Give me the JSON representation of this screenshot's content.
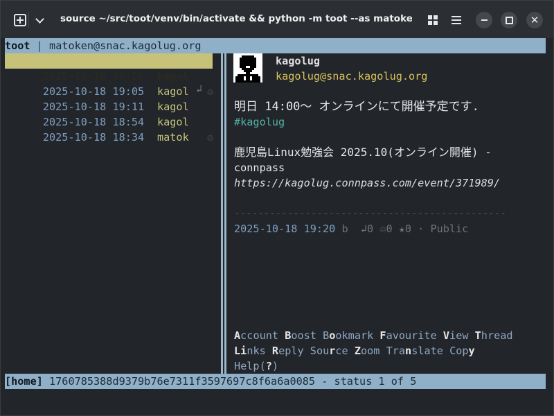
{
  "window": {
    "title": "source ~/src/toot/venv/bin/activate && python -m toot --as matoken@sna…"
  },
  "header": {
    "app": "toot",
    "separator": "|",
    "user": "matoken@snac.kagolug.org"
  },
  "timeline": [
    {
      "time": "2025-10-18 19:20",
      "account": "kagol",
      "icon": "",
      "selected": true
    },
    {
      "time": "2025-10-18 19:05",
      "account": "kagol",
      "icon": "♲",
      "icon_name": "boost-icon"
    },
    {
      "time": "2025-10-18 19:11",
      "account": "kagol",
      "icon": "↲",
      "icon_name": "reply-icon"
    },
    {
      "time": "2025-10-18 18:54",
      "account": "kagol",
      "icon": ""
    },
    {
      "time": "2025-10-18 18:34",
      "account": "matok",
      "icon": "♲",
      "icon_name": "boost-icon"
    }
  ],
  "status": {
    "display_name": "kagolug",
    "account": "kagolug@snac.kagolug.org",
    "line1": "明日 14:00〜 オンラインにて開催予定です.",
    "hashtag": "#kagolug",
    "line2": "鹿児島Linux勉強会 2025.10(オンライン開催) -",
    "line3": "connpass",
    "url": "https://kagolug.connpass.com/event/371989/",
    "divider": "----------------------------------------------",
    "meta_time": "2025-10-18 19:20",
    "meta_rest": " b  ↲0 ♲0 ★0 · Public"
  },
  "keys_line1": [
    {
      "k": "A",
      "rest": "ccount"
    },
    {
      "k": "B",
      "rest": "oost"
    },
    {
      "k": "",
      "pre": "B",
      "k2": "o",
      "rest": "okmark"
    },
    {
      "k": "F",
      "rest": "avourite"
    },
    {
      "k": "V",
      "rest": "iew"
    },
    {
      "k": "T",
      "rest": "hread"
    }
  ],
  "keys": {
    "account": [
      "A",
      "ccount"
    ],
    "boost": [
      "B",
      "oost"
    ],
    "bookmark": [
      "B",
      "o",
      "okmark"
    ],
    "favourite": [
      "F",
      "avourite"
    ],
    "view": [
      "V",
      "iew"
    ],
    "thread": [
      "T",
      "hread"
    ],
    "links": [
      "L",
      "i",
      "nks"
    ],
    "reply": [
      "R",
      "eply"
    ],
    "source": [
      "Sou",
      "r",
      "ce"
    ],
    "zoom": [
      "Z",
      "oom"
    ],
    "translate": [
      "Tra",
      "n",
      "slate"
    ],
    "copy": [
      "Cop",
      "y"
    ],
    "help": [
      "Help(",
      "?",
      ")"
    ]
  },
  "footer": {
    "home": "[home]",
    "status_id": " 1760785388d9379b76e7311f3597697c8f6a6a0085 - status 1 of 5"
  },
  "colors": {
    "bar": "#8fb0c8",
    "selected": "#c6c27a",
    "hashtag": "#54b3a6",
    "account": "#d9c25c",
    "timestamp": "#7f9fc0"
  }
}
